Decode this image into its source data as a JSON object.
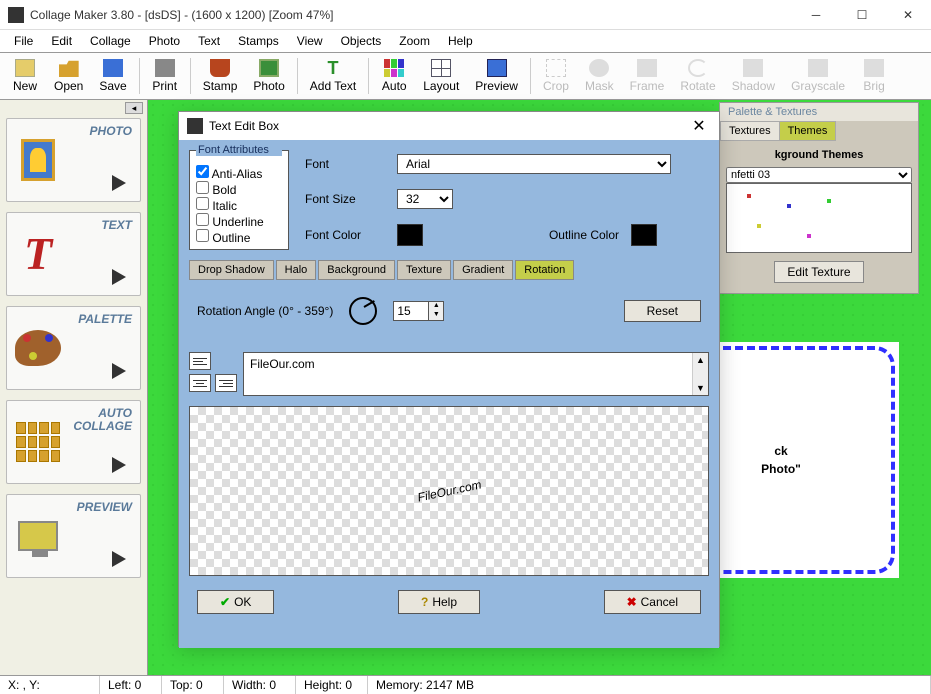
{
  "title": "Collage Maker 3.80  - [dsDS] - (1600 x 1200)   [Zoom 47%]",
  "menus": [
    "File",
    "Edit",
    "Collage",
    "Photo",
    "Text",
    "Stamps",
    "View",
    "Objects",
    "Zoom",
    "Help"
  ],
  "toolbar": {
    "enabled": [
      {
        "label": "New",
        "color": "#e5cc6a"
      },
      {
        "label": "Open",
        "color": "#d6a12e"
      },
      {
        "label": "Save",
        "color": "#3a6fd6"
      },
      {
        "label": "Print",
        "color": "#888"
      },
      {
        "label": "Stamp",
        "color": "#b7451e"
      },
      {
        "label": "Photo",
        "color": "#3a8f3a"
      },
      {
        "label": "Add Text",
        "color": "#2a8f2a"
      },
      {
        "label": "Auto",
        "color": "#c33"
      },
      {
        "label": "Layout",
        "color": "#556"
      },
      {
        "label": "Preview",
        "color": "#3a6fd6"
      }
    ],
    "disabled": [
      "Crop",
      "Mask",
      "Frame",
      "Rotate",
      "Shadow",
      "Grayscale",
      "Brig"
    ]
  },
  "sidebar": [
    {
      "label": "PHOTO"
    },
    {
      "label": "TEXT"
    },
    {
      "label": "PALETTE"
    },
    {
      "label": "AUTO\nCOLLAGE"
    },
    {
      "label": "PREVIEW"
    }
  ],
  "palette_panel": {
    "title": "Palette & Textures",
    "tabs": [
      "",
      "Textures",
      "Themes"
    ],
    "active_tab": "Themes",
    "heading": "kground Themes",
    "select_value": "nfetti 03",
    "button": "Edit Texture"
  },
  "photo_frame": {
    "line1": "ck",
    "line2": "Photo\""
  },
  "dialog": {
    "title": "Text Edit Box",
    "font_attrs_label": "Font Attributes",
    "checks": [
      {
        "label": "Anti-Alias",
        "checked": true
      },
      {
        "label": "Bold",
        "checked": false
      },
      {
        "label": "Italic",
        "checked": false
      },
      {
        "label": "Underline",
        "checked": false
      },
      {
        "label": "Outline",
        "checked": false
      }
    ],
    "font_label": "Font",
    "font_value": "Arial",
    "size_label": "Font Size",
    "size_value": "32",
    "color_label": "Font Color",
    "outline_label": "Outline Color",
    "tabs": [
      "Drop Shadow",
      "Halo",
      "Background",
      "Texture",
      "Gradient",
      "Rotation"
    ],
    "active_tab": "Rotation",
    "rotation_label": "Rotation Angle (0° - 359°)",
    "rotation_value": "15",
    "reset_label": "Reset",
    "text_value": "FileOur.com",
    "preview_text": "FileOur.com",
    "ok": "OK",
    "help": "Help",
    "cancel": "Cancel"
  },
  "status": {
    "xy": "X: , Y:",
    "left": "Left: 0",
    "top": "Top: 0",
    "width": "Width: 0",
    "height": "Height: 0",
    "memory": "Memory: 2147 MB"
  }
}
